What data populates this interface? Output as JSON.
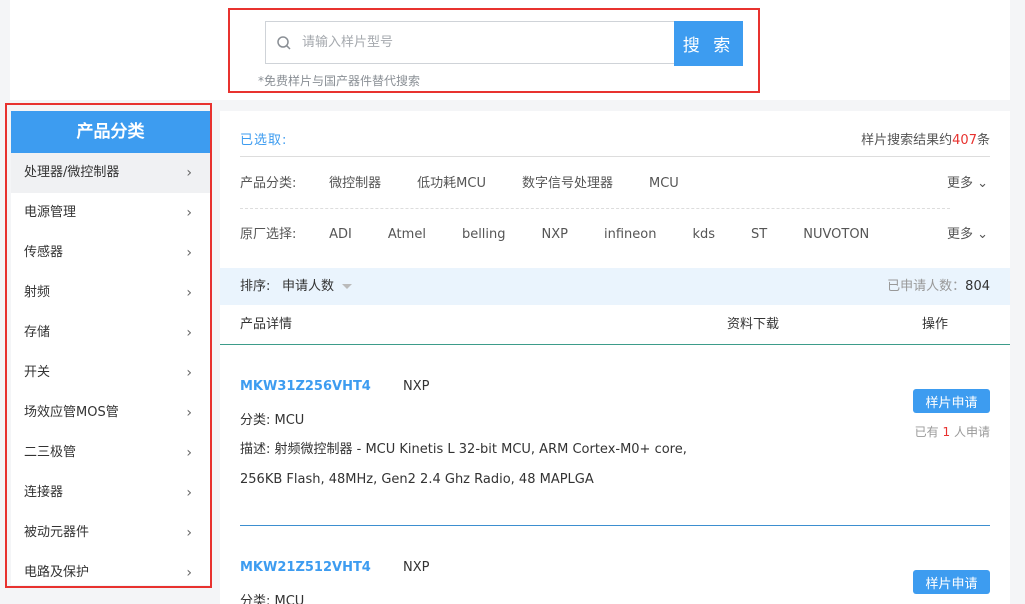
{
  "search": {
    "placeholder": "请输入样片型号",
    "button_label": "搜 索",
    "hint": "*免费样片与国产器件替代搜索"
  },
  "sidebar": {
    "title": "产品分类",
    "items": [
      {
        "label": "处理器/微控制器"
      },
      {
        "label": "电源管理"
      },
      {
        "label": "传感器"
      },
      {
        "label": "射频"
      },
      {
        "label": "存储"
      },
      {
        "label": "开关"
      },
      {
        "label": "场效应管MOS管"
      },
      {
        "label": "二三极管"
      },
      {
        "label": "连接器"
      },
      {
        "label": "被动元器件"
      },
      {
        "label": "电路及保护"
      }
    ],
    "chevron": "›"
  },
  "filters": {
    "selected_label": "已选取:",
    "result_prefix": "样片搜索结果约",
    "result_count": "407",
    "result_suffix": "条",
    "category": {
      "label": "产品分类:",
      "options": [
        "微控制器",
        "低功耗MCU",
        "数字信号处理器",
        "MCU"
      ],
      "more": "更多"
    },
    "manufacturer": {
      "label": "原厂选择:",
      "options": [
        "ADI",
        "Atmel",
        "belling",
        "NXP",
        "infineon",
        "kds",
        "ST",
        "NUVOTON"
      ],
      "more": "更多"
    }
  },
  "sort": {
    "label": "排序:",
    "value": "申请人数",
    "applied_label": "已申请人数：",
    "applied_count": "804"
  },
  "table": {
    "headers": {
      "detail": "产品详情",
      "download": "资料下载",
      "operation": "操作"
    }
  },
  "products": [
    {
      "part": "MKW31Z256VHT4",
      "brand": "NXP",
      "category": "分类: MCU",
      "description": "描述: 射频微控制器 - MCU Kinetis L 32-bit MCU, ARM Cortex-M0+ core, 256KB Flash, 48MHz, Gen2 2.4 Ghz Radio, 48 MAPLGA",
      "apply_label": "样片申请",
      "count_prefix": "已有",
      "count": "1",
      "count_suffix": "人申请"
    },
    {
      "part": "MKW21Z512VHT4",
      "brand": "NXP",
      "category": "分类: MCU",
      "apply_label": "样片申请"
    }
  ],
  "colors": {
    "accent": "#3d9cf0",
    "highlight_red": "#e8322f"
  }
}
